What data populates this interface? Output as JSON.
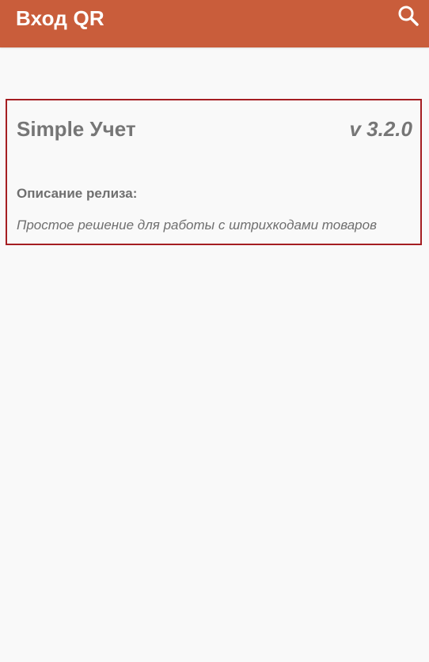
{
  "app_bar": {
    "title": "Вход QR",
    "search_icon": "search-icon",
    "background_color": "#c95d3b"
  },
  "release_card": {
    "app_name": "Simple Учет",
    "version": "v 3.2.0",
    "description_heading": "Описание релиза:",
    "description_text": "Простое решение для работы с штрихкодами товаров",
    "border_color": "#a51e22"
  }
}
